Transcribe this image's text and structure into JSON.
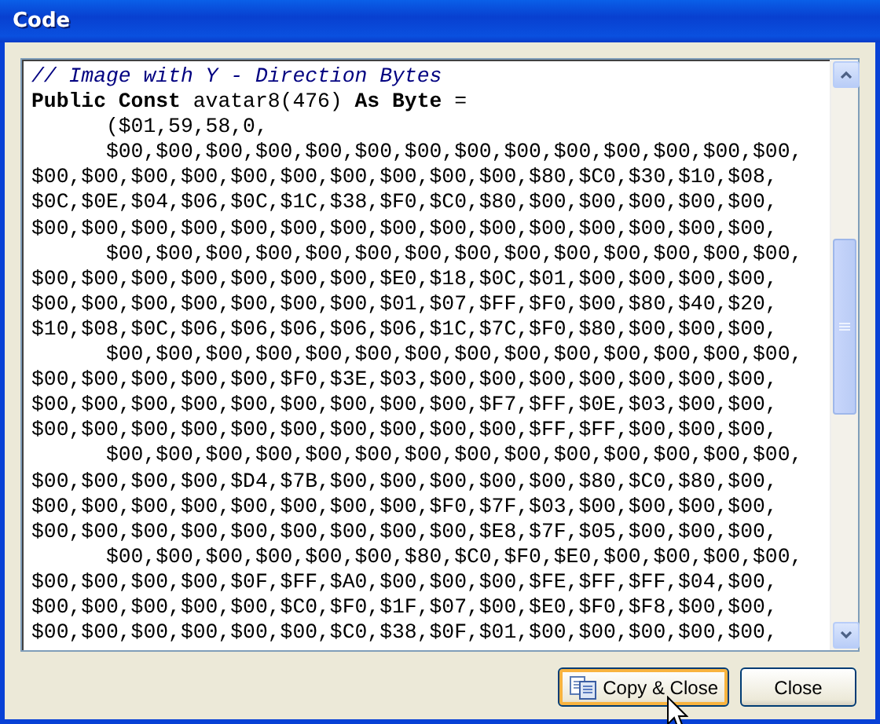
{
  "window": {
    "title": "Code"
  },
  "code_lines": [
    {
      "kind": "comment",
      "text": "// Image with Y - Direction Bytes"
    },
    {
      "kind": "code",
      "text": "**Public Const** avatar8(476) **As Byte** ="
    },
    {
      "kind": "code",
      "text": "      ($01,59,58,0,"
    },
    {
      "kind": "code",
      "text": "      $00,$00,$00,$00,$00,$00,$00,$00,$00,$00,$00,$00,$00,$00,"
    },
    {
      "kind": "code",
      "text": "$00,$00,$00,$00,$00,$00,$00,$00,$00,$00,$80,$C0,$30,$10,$08,"
    },
    {
      "kind": "code",
      "text": "$0C,$0E,$04,$06,$0C,$1C,$38,$F0,$C0,$80,$00,$00,$00,$00,$00,"
    },
    {
      "kind": "code",
      "text": "$00,$00,$00,$00,$00,$00,$00,$00,$00,$00,$00,$00,$00,$00,$00,"
    },
    {
      "kind": "code",
      "text": "      $00,$00,$00,$00,$00,$00,$00,$00,$00,$00,$00,$00,$00,$00,"
    },
    {
      "kind": "code",
      "text": "$00,$00,$00,$00,$00,$00,$00,$E0,$18,$0C,$01,$00,$00,$00,$00,"
    },
    {
      "kind": "code",
      "text": "$00,$00,$00,$00,$00,$00,$00,$01,$07,$FF,$F0,$00,$80,$40,$20,"
    },
    {
      "kind": "code",
      "text": "$10,$08,$0C,$06,$06,$06,$06,$06,$1C,$7C,$F0,$80,$00,$00,$00,"
    },
    {
      "kind": "code",
      "text": "      $00,$00,$00,$00,$00,$00,$00,$00,$00,$00,$00,$00,$00,$00,"
    },
    {
      "kind": "code",
      "text": "$00,$00,$00,$00,$00,$F0,$3E,$03,$00,$00,$00,$00,$00,$00,$00,"
    },
    {
      "kind": "code",
      "text": "$00,$00,$00,$00,$00,$00,$00,$00,$00,$F7,$FF,$0E,$03,$00,$00,"
    },
    {
      "kind": "code",
      "text": "$00,$00,$00,$00,$00,$00,$00,$00,$00,$00,$FF,$FF,$00,$00,$00,"
    },
    {
      "kind": "code",
      "text": "      $00,$00,$00,$00,$00,$00,$00,$00,$00,$00,$00,$00,$00,$00,"
    },
    {
      "kind": "code",
      "text": "$00,$00,$00,$00,$D4,$7B,$00,$00,$00,$00,$00,$80,$C0,$80,$00,"
    },
    {
      "kind": "code",
      "text": "$00,$00,$00,$00,$00,$00,$00,$00,$F0,$7F,$03,$00,$00,$00,$00,"
    },
    {
      "kind": "code",
      "text": "$00,$00,$00,$00,$00,$00,$00,$00,$00,$E8,$7F,$05,$00,$00,$00,"
    },
    {
      "kind": "code",
      "text": "      $00,$00,$00,$00,$00,$00,$80,$C0,$F0,$E0,$00,$00,$00,$00,"
    },
    {
      "kind": "code",
      "text": "$00,$00,$00,$00,$0F,$FF,$A0,$00,$00,$00,$FE,$FF,$FF,$04,$00,"
    },
    {
      "kind": "code",
      "text": "$00,$00,$00,$00,$00,$C0,$F0,$1F,$07,$00,$E0,$F0,$F8,$00,$00,"
    },
    {
      "kind": "code",
      "text": "$00,$00,$00,$00,$00,$00,$C0,$38,$0F,$01,$00,$00,$00,$00,$00,"
    }
  ],
  "buttons": [
    {
      "kind": "copy",
      "label": "Copy & Close",
      "focused": true
    },
    {
      "kind": "plain",
      "label": "Close",
      "focused": false
    }
  ]
}
